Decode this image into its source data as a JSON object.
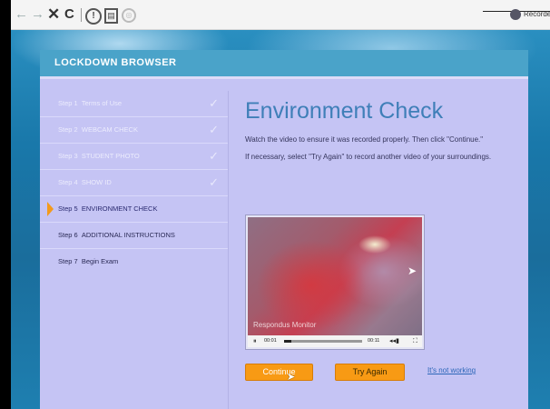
{
  "browser": {
    "back_icon": "←",
    "forward_icon": "→",
    "stop_icon": "✕",
    "reload_icon": "C",
    "info_icon": "!",
    "doc_icon": "▤",
    "camera_icon": "◎",
    "extension_label": "Recorde"
  },
  "header": {
    "title": "LOCKDOWN BROWSER"
  },
  "steps": [
    {
      "num": "Step 1",
      "label": "Terms of Use",
      "check": "✓"
    },
    {
      "num": "Step 2",
      "label": "WEBCAM CHECK",
      "check": "✓"
    },
    {
      "num": "Step 3",
      "label": "STUDENT PHOTO",
      "check": "✓"
    },
    {
      "num": "Step 4",
      "label": "SHOW ID",
      "check": "✓"
    },
    {
      "num": "Step 5",
      "label": "ENVIRONMENT CHECK"
    },
    {
      "num": "Step 6",
      "label": "ADDITIONAL INSTRUCTIONS"
    },
    {
      "num": "Step 7",
      "label": "Begin Exam"
    }
  ],
  "main": {
    "title": "Environment Check",
    "instruction_1": "Watch the video to ensure it was recorded properly. Then click \"Continue.\"",
    "instruction_2": "If necessary, select \"Try Again\" to record another video of your surroundings."
  },
  "video": {
    "watermark": "Respondus Monitor",
    "current_time": "00:01",
    "duration": "00:11",
    "progress_fraction": 0.09,
    "play_icon": "⏸",
    "volume_icon": "◂◂▮",
    "fullscreen_icon": "⛶"
  },
  "actions": {
    "continue_label": "Continue",
    "try_again_label": "Try Again",
    "not_working_label": "It's not working"
  },
  "colors": {
    "accent_orange": "#f89a14",
    "header_blue": "#4aa3c9",
    "panel_lavender": "#c5c4f4",
    "title_blue": "#3f7fb8"
  }
}
